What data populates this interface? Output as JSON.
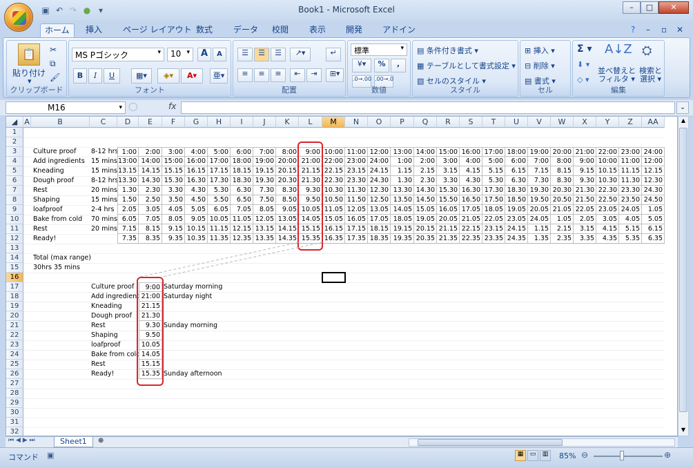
{
  "window": {
    "title": "Book1 - Microsoft Excel",
    "min": "–",
    "max": "□",
    "close": "✕"
  },
  "ribbon_tabs": [
    "ホーム",
    "挿入",
    "ページ レイアウト",
    "数式",
    "データ",
    "校閲",
    "表示",
    "開発",
    "アドイン"
  ],
  "clipboard": {
    "paste": "貼り付け",
    "label": "クリップボード"
  },
  "font": {
    "name": "MS Pゴシック",
    "size": "10",
    "label": "フォント",
    "bold": "B",
    "italic": "I",
    "underline": "U"
  },
  "alignment": {
    "label": "配置"
  },
  "number": {
    "format": "標準",
    "label": "数値",
    "percent": "%",
    "comma": ","
  },
  "styles": {
    "conditional": "条件付き書式",
    "table": "テーブルとして書式設定",
    "cell": "セルのスタイル",
    "label": "スタイル"
  },
  "cells": {
    "insert": "挿入",
    "delete": "削除",
    "format": "書式",
    "label": "セル"
  },
  "editing": {
    "sigma": "Σ",
    "sort": "並べ替えと\nフィルタ",
    "find": "検索と\n選択",
    "label": "編集",
    "sort_l1": "並べ替えと",
    "sort_l2": "フィルタ",
    "find_l1": "検索と",
    "find_l2": "選択"
  },
  "namebox": "M16",
  "fx": "fx",
  "columns": [
    "A",
    "B",
    "C",
    "D",
    "E",
    "F",
    "G",
    "H",
    "I",
    "J",
    "K",
    "L",
    "M",
    "N",
    "O",
    "P",
    "Q",
    "R",
    "S",
    "T",
    "U",
    "V",
    "W",
    "X",
    "Y",
    "Z",
    "AA"
  ],
  "rows": [
    "1",
    "2",
    "3",
    "4",
    "5",
    "6",
    "7",
    "8",
    "9",
    "10",
    "11",
    "12",
    "13",
    "14",
    "15",
    "16",
    "17",
    "18",
    "19",
    "20",
    "21",
    "22",
    "23",
    "24",
    "25",
    "26",
    "27",
    "28",
    "29",
    "30",
    "31",
    "32"
  ],
  "steps": [
    {
      "name": "Culture proof",
      "dur": "8-12 hrs",
      "vals": [
        "1:00",
        "2:00",
        "3:00",
        "4:00",
        "5:00",
        "6:00",
        "7:00",
        "8:00",
        "9:00",
        "10:00",
        "11:00",
        "12:00",
        "13:00",
        "14:00",
        "15:00",
        "16:00",
        "17:00",
        "18:00",
        "19:00",
        "20:00",
        "21:00",
        "22:00",
        "23:00",
        "24:00"
      ]
    },
    {
      "name": "Add ingredients",
      "dur": "15 mins",
      "vals": [
        "13:00",
        "14:00",
        "15:00",
        "16:00",
        "17:00",
        "18:00",
        "19:00",
        "20:00",
        "21:00",
        "22:00",
        "23:00",
        "24:00",
        "1:00",
        "2:00",
        "3:00",
        "4:00",
        "5:00",
        "6:00",
        "7:00",
        "8:00",
        "9:00",
        "10:00",
        "11:00",
        "12:00"
      ]
    },
    {
      "name": "Kneading",
      "dur": "15 mins",
      "vals": [
        "13.15",
        "14.15",
        "15.15",
        "16.15",
        "17.15",
        "18.15",
        "19.15",
        "20.15",
        "21.15",
        "22.15",
        "23.15",
        "24.15",
        "1.15",
        "2.15",
        "3.15",
        "4.15",
        "5.15",
        "6.15",
        "7.15",
        "8.15",
        "9.15",
        "10.15",
        "11.15",
        "12.15"
      ]
    },
    {
      "name": "Dough proof",
      "dur": "8-12 hrs",
      "vals": [
        "13.30",
        "14.30",
        "15.30",
        "16.30",
        "17.30",
        "18.30",
        "19.30",
        "20.30",
        "21.30",
        "22.30",
        "23.30",
        "24.30",
        "1.30",
        "2.30",
        "3.30",
        "4.30",
        "5.30",
        "6.30",
        "7.30",
        "8.30",
        "9.30",
        "10.30",
        "11.30",
        "12.30"
      ]
    },
    {
      "name": "Rest",
      "dur": "20 mins",
      "vals": [
        "1.30",
        "2.30",
        "3.30",
        "4.30",
        "5.30",
        "6.30",
        "7.30",
        "8.30",
        "9.30",
        "10.30",
        "11.30",
        "12.30",
        "13.30",
        "14.30",
        "15.30",
        "16.30",
        "17.30",
        "18.30",
        "19.30",
        "20.30",
        "21.30",
        "22.30",
        "23.30",
        "24.30"
      ]
    },
    {
      "name": "Shaping",
      "dur": "15 mins",
      "vals": [
        "1.50",
        "2.50",
        "3.50",
        "4.50",
        "5.50",
        "6.50",
        "7.50",
        "8.50",
        "9.50",
        "10.50",
        "11.50",
        "12.50",
        "13.50",
        "14.50",
        "15.50",
        "16.50",
        "17.50",
        "18.50",
        "19.50",
        "20.50",
        "21.50",
        "22.50",
        "23.50",
        "24.50"
      ]
    },
    {
      "name": "loafproof",
      "dur": "2-4 hrs",
      "vals": [
        "2.05",
        "3.05",
        "4.05",
        "5.05",
        "6.05",
        "7.05",
        "8.05",
        "9.05",
        "10.05",
        "11.05",
        "12.05",
        "13.05",
        "14.05",
        "15.05",
        "16.05",
        "17.05",
        "18.05",
        "19.05",
        "20.05",
        "21.05",
        "22.05",
        "23.05",
        "24.05",
        "1.05"
      ]
    },
    {
      "name": "Bake from cold",
      "dur": "70 mins",
      "vals": [
        "6.05",
        "7.05",
        "8.05",
        "9.05",
        "10.05",
        "11.05",
        "12.05",
        "13.05",
        "14.05",
        "15.05",
        "16.05",
        "17.05",
        "18.05",
        "19.05",
        "20.05",
        "21.05",
        "22.05",
        "23.05",
        "24.05",
        "1.05",
        "2.05",
        "3.05",
        "4.05",
        "5.05"
      ]
    },
    {
      "name": "Rest",
      "dur": "20 mins",
      "vals": [
        "7.15",
        "8.15",
        "9.15",
        "10.15",
        "11.15",
        "12.15",
        "13.15",
        "14.15",
        "15.15",
        "16.15",
        "17.15",
        "18.15",
        "19.15",
        "20.15",
        "21.15",
        "22.15",
        "23.15",
        "24.15",
        "1.15",
        "2.15",
        "3.15",
        "4.15",
        "5.15",
        "6.15"
      ]
    },
    {
      "name": "Ready!",
      "dur": "",
      "vals": [
        "7.35",
        "8.35",
        "9.35",
        "10.35",
        "11.35",
        "12.35",
        "13.35",
        "14.35",
        "15.35",
        "16.35",
        "17.35",
        "18.35",
        "19.35",
        "20.35",
        "21.35",
        "22.35",
        "23.35",
        "24.35",
        "1.35",
        "2.35",
        "3.35",
        "4.35",
        "5.35",
        "6.35"
      ]
    }
  ],
  "total_label": "Total (max range)",
  "total_value": "30hrs 35 mins",
  "summary": [
    {
      "name": "Culture proof",
      "val": "9:00",
      "note": "Saturday morning"
    },
    {
      "name": "Add ingredients",
      "val": "21:00",
      "note": "Saturday night"
    },
    {
      "name": "Kneading",
      "val": "21.15",
      "note": ""
    },
    {
      "name": "Dough proof",
      "val": "21.30",
      "note": ""
    },
    {
      "name": "Rest",
      "val": "9.30",
      "note": "Sunday morning"
    },
    {
      "name": "Shaping",
      "val": "9.50",
      "note": ""
    },
    {
      "name": "loafproof",
      "val": "10.05",
      "note": ""
    },
    {
      "name": "Bake from cold",
      "val": "14.05",
      "note": ""
    },
    {
      "name": "Rest",
      "val": "15.15",
      "note": ""
    },
    {
      "name": "Ready!",
      "val": "15.35",
      "note": "Sunday afternoon"
    }
  ],
  "sheet_tab": "Sheet1",
  "status": {
    "mode": "コマンド",
    "zoom": "85%"
  }
}
